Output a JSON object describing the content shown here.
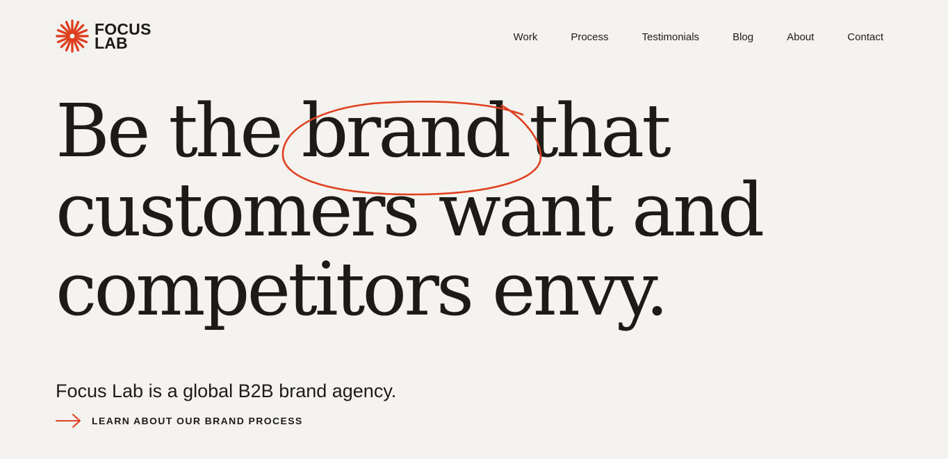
{
  "brand": {
    "logo_line1": "FOCUS",
    "logo_line2": "LAB",
    "accent_color": "#e0401f",
    "logo_icon": "sunburst-icon"
  },
  "nav": {
    "items": [
      {
        "label": "Work"
      },
      {
        "label": "Process"
      },
      {
        "label": "Testimonials"
      },
      {
        "label": "Blog"
      },
      {
        "label": "About"
      },
      {
        "label": "Contact"
      }
    ]
  },
  "hero": {
    "headline_lines": [
      "Be the brand that",
      "customers want and",
      "competitors envy."
    ],
    "circled_word": "brand",
    "subhead": "Focus Lab is a global B2B brand agency.",
    "cta_label": "LEARN ABOUT OUR BRAND PROCESS",
    "cta_icon": "arrow-right-icon"
  }
}
